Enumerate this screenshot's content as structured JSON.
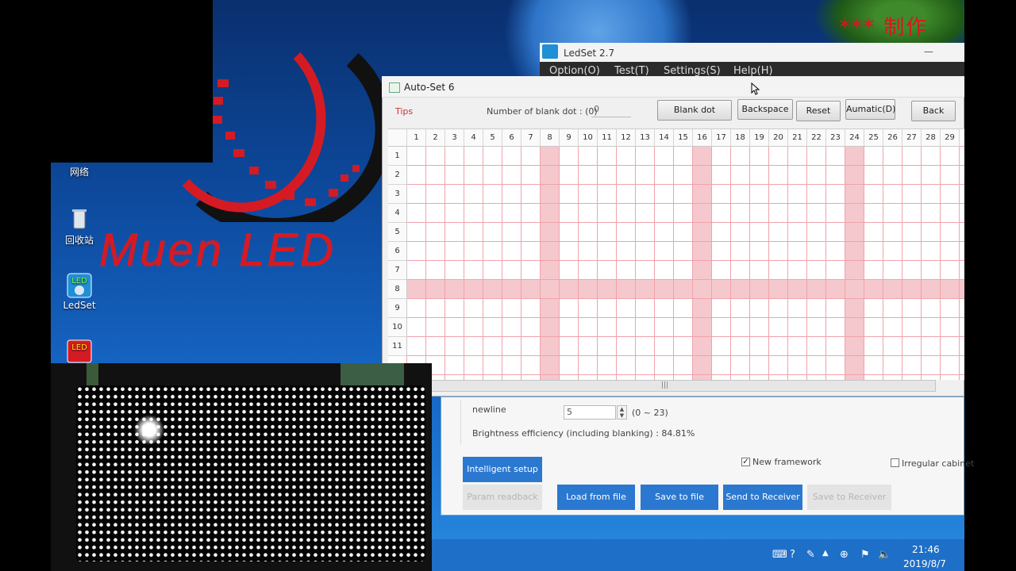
{
  "desktop": {
    "watermark": "*** 制作",
    "logo_text": "Muen LED",
    "icons": [
      {
        "label": "网络",
        "icon": "network-icon"
      },
      {
        "label": "回收站",
        "icon": "recycle-bin-icon"
      },
      {
        "label": "LedSet",
        "icon": "ledset-icon"
      },
      {
        "label": "",
        "icon": "led-player-icon"
      }
    ]
  },
  "ledset_window": {
    "title": "LedSet 2.7",
    "menu": [
      "Option(O)",
      "Test(T)",
      "Settings(S)",
      "Help(H)"
    ],
    "minimize": "—"
  },
  "autoset_window": {
    "title": "Auto-Set 6",
    "tips": "Tips",
    "blank_dot_label": "Number of blank dot : (0)",
    "blank_dot_value": "0",
    "buttons": [
      "Blank dot",
      "Backspace",
      "Reset",
      "Aumatic(D)",
      "Back"
    ],
    "columns": [
      "1",
      "2",
      "3",
      "4",
      "5",
      "6",
      "7",
      "8",
      "9",
      "10",
      "11",
      "12",
      "13",
      "14",
      "15",
      "16",
      "17",
      "18",
      "19",
      "20",
      "21",
      "22",
      "23",
      "24",
      "25",
      "26",
      "27",
      "28",
      "29"
    ],
    "rows": [
      "1",
      "2",
      "3",
      "4",
      "5",
      "6",
      "7",
      "8",
      "9",
      "10",
      "11"
    ],
    "highlight_columns": [
      "8",
      "16",
      "24"
    ],
    "highlight_row": "8",
    "scroll_grip": "|||"
  },
  "lower_panel": {
    "newline_label": "newline",
    "newline_value": "5",
    "newline_range": "(0 ~ 23)",
    "brightness": "Brightness efficiency (including blanking) : 84.81%",
    "new_framework_label": "New framework",
    "new_framework_checked": true,
    "irregular_cabinet_label": "Irregular cabinet",
    "irregular_cabinet_checked": false,
    "intelligent_setup": "Intelligent setup",
    "param_readback": "Param readback",
    "load_from_file": "Load from file",
    "save_to_file": "Save to file",
    "send_to_receiver": "Send to Receiver",
    "save_to_receiver": "Save to Receiver"
  },
  "taskbar": {
    "time": "21:46",
    "date": "2019/8/7"
  },
  "colors": {
    "accent_blue": "#2b78d0",
    "grid_line": "#f0a3ab",
    "highlight": "#f5c8cd",
    "logo_red": "#d41b24"
  }
}
